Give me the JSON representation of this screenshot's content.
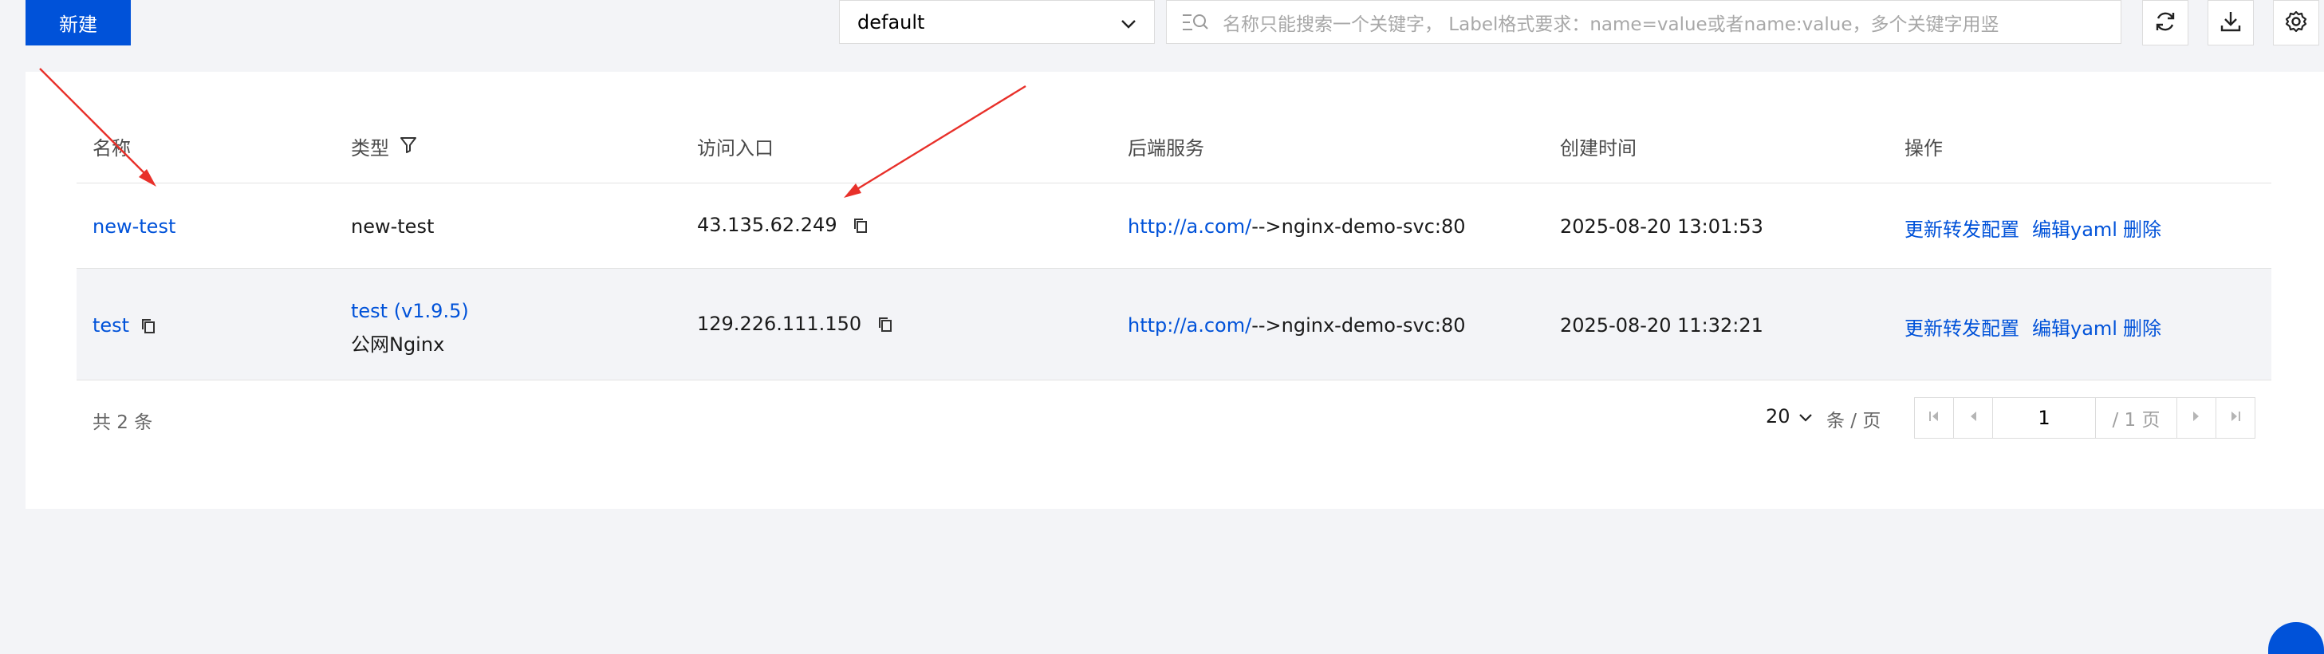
{
  "toolbar": {
    "new_button": "新建",
    "namespace": "default",
    "search_placeholder": "名称只能搜索一个关键字， Label格式要求：name=value或者name:value，多个关键字用竖"
  },
  "table": {
    "headers": {
      "name": "名称",
      "type": "类型",
      "entry": "访问入口",
      "backend": "后端服务",
      "created": "创建时间",
      "actions": "操作"
    },
    "rows": [
      {
        "name": "new-test",
        "type": "new-test",
        "type_sub": "",
        "entry": "43.135.62.249",
        "backend_link": "http://a.com/",
        "backend_rest": "-->nginx-demo-svc:80",
        "created": "2025-08-20 13:01:53",
        "op_update": "更新转发配置",
        "op_edit": "编辑yaml",
        "op_delete": "删除"
      },
      {
        "name": "test",
        "type": "test (v1.9.5)",
        "type_sub": "公网Nginx",
        "entry": "129.226.111.150",
        "backend_link": "http://a.com/",
        "backend_rest": "-->nginx-demo-svc:80",
        "created": "2025-08-20 11:32:21",
        "op_update": "更新转发配置",
        "op_edit": "编辑yaml",
        "op_delete": "删除"
      }
    ]
  },
  "pagination": {
    "total": "共 2 条",
    "page_size": "20",
    "unit": "条 / 页",
    "current_page": "1",
    "total_pages": "/ 1 页"
  },
  "colors": {
    "primary": "#0052d9",
    "annotation_arrow": "#e8302a",
    "background": "#f3f4f7"
  }
}
